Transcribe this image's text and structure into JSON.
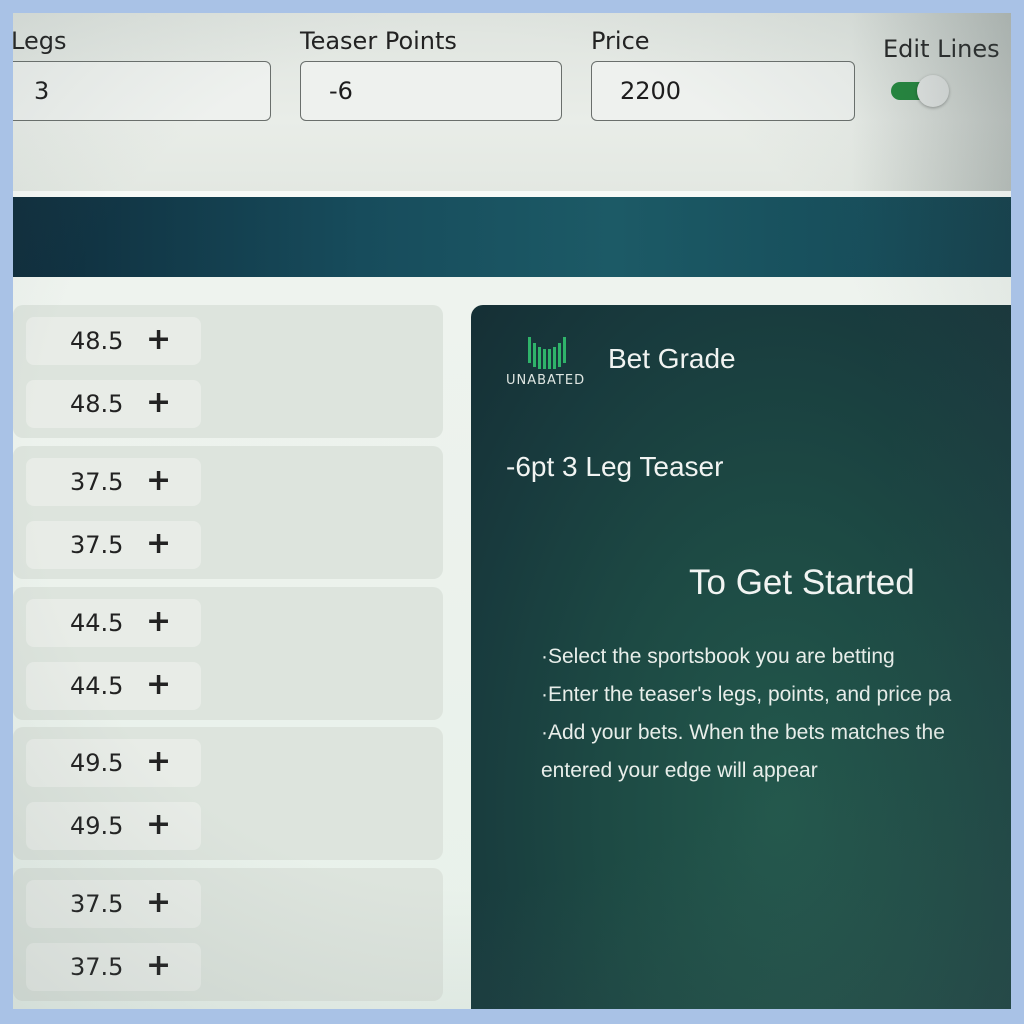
{
  "fields": {
    "legs": {
      "label": "Legs",
      "value": "3"
    },
    "teaser_points": {
      "label": "Teaser Points",
      "value": "-6"
    },
    "price": {
      "label": "Price",
      "value": "2200"
    },
    "edit_lines": {
      "label": "Edit Lines",
      "enabled": true
    }
  },
  "groups": [
    {
      "lines": [
        {
          "value": "48.5",
          "action": "+"
        },
        {
          "value": "48.5",
          "action": "+"
        }
      ]
    },
    {
      "lines": [
        {
          "value": "37.5",
          "action": "+"
        },
        {
          "value": "37.5",
          "action": "+"
        }
      ]
    },
    {
      "lines": [
        {
          "value": "44.5",
          "action": "+"
        },
        {
          "value": "44.5",
          "action": "+"
        }
      ]
    },
    {
      "lines": [
        {
          "value": "49.5",
          "action": "+"
        },
        {
          "value": "49.5",
          "action": "+"
        }
      ]
    },
    {
      "lines": [
        {
          "value": "37.5",
          "action": "+"
        },
        {
          "value": "37.5",
          "action": "+"
        }
      ]
    }
  ],
  "panel": {
    "logo_text": "UNABATED",
    "title": "Bet Grade",
    "teaser_title": "-6pt 3 Leg Teaser",
    "heading": "To Get Started",
    "instructions": [
      "·Select the sportsbook you are betting",
      "·Enter the teaser's legs, points, and price pa",
      "·Add your bets. When the bets matches the",
      "entered your edge will appear"
    ]
  },
  "colors": {
    "accent_green": "#1f8a3a",
    "banner": "#174c5c",
    "panel_bg": "#1d4a44",
    "logo_green": "#2fb36a"
  }
}
